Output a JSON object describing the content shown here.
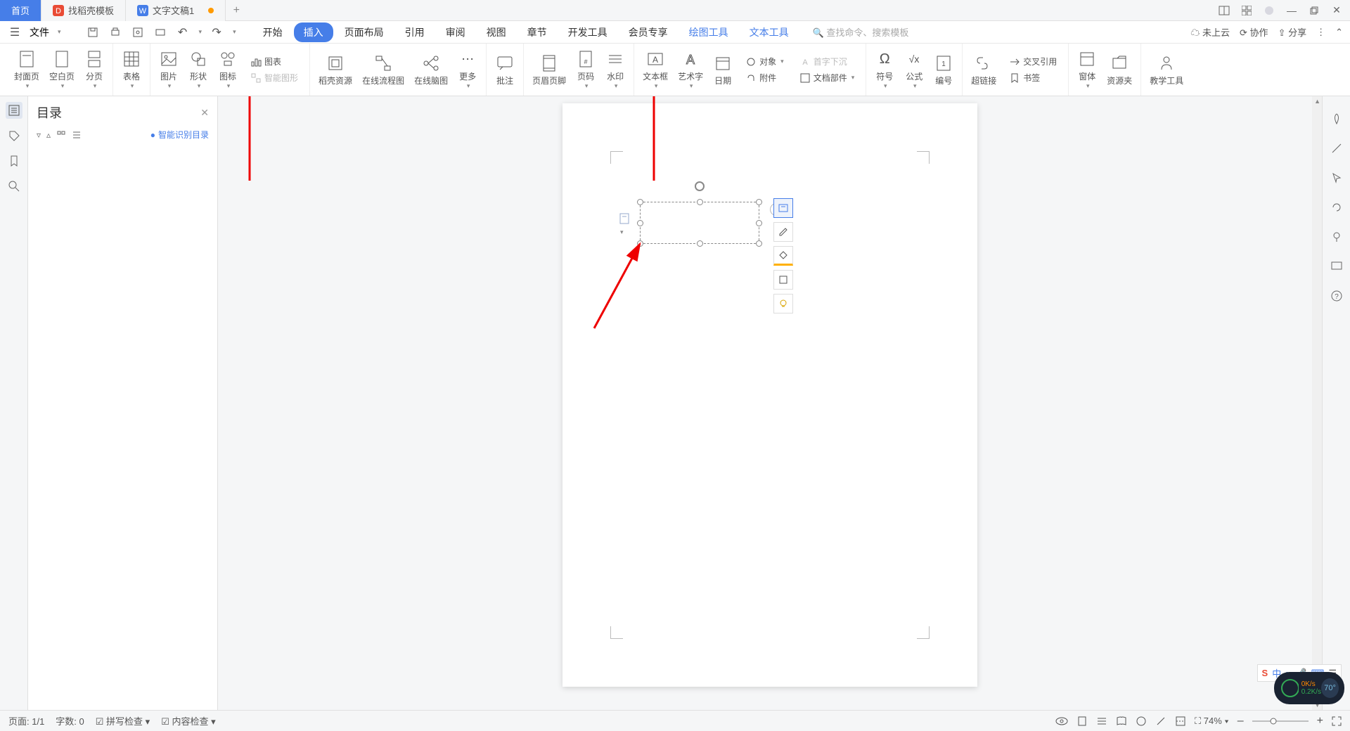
{
  "tabs": {
    "home": "首页",
    "template": "找稻壳模板",
    "doc": "文字文稿1"
  },
  "menubar": {
    "file": "文件",
    "tabs": [
      "开始",
      "插入",
      "页面布局",
      "引用",
      "审阅",
      "视图",
      "章节",
      "开发工具",
      "会员专享"
    ],
    "context": [
      "绘图工具",
      "文本工具"
    ],
    "search_placeholder": "查找命令、搜索模板",
    "cloud": "未上云",
    "coop": "协作",
    "share": "分享"
  },
  "ribbon": {
    "cover": "封面页",
    "blank": "空白页",
    "pagebreak": "分页",
    "table": "表格",
    "picture": "图片",
    "shape": "形状",
    "icon": "图标",
    "chart": "图表",
    "smartart": "智能图形",
    "resource": "稻壳资源",
    "flowchart": "在线流程图",
    "mindmap": "在线脑图",
    "more": "更多",
    "comment": "批注",
    "headerfooter": "页眉页脚",
    "pagenum": "页码",
    "watermark": "水印",
    "textbox": "文本框",
    "wordart": "艺术字",
    "date": "日期",
    "object": "对象",
    "attachment": "附件",
    "dropcap": "首字下沉",
    "docparts": "文档部件",
    "symbol": "符号",
    "equation": "公式",
    "number": "编号",
    "hyperlink": "超链接",
    "crossref": "交叉引用",
    "bookmark": "书签",
    "window": "窗体",
    "resourcelib": "资源夹",
    "teaching": "教学工具"
  },
  "toc": {
    "title": "目录",
    "smart": "智能识别目录"
  },
  "status": {
    "page": "页面: 1/1",
    "words": "字数: 0",
    "spell": "拼写检查",
    "content": "内容检查",
    "zoom": "74%"
  },
  "ime": {
    "lang": "中"
  },
  "syswidget": {
    "up": "0K/s",
    "down": "0.2K/s",
    "temp": "70°"
  }
}
